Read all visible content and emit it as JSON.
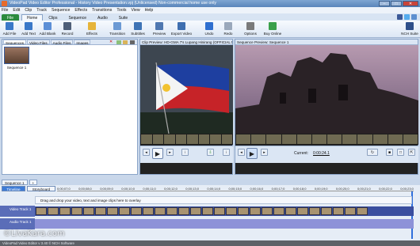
{
  "window": {
    "title": "VideoPad Video Editor Professional - History Video Presentation.vpj (Unlicensed) Non-commercial home use only",
    "controls": [
      "–",
      "□",
      "✕"
    ]
  },
  "menu": [
    "File",
    "Edit",
    "Clip",
    "Track",
    "Sequence",
    "Effects",
    "Transitions",
    "Tools",
    "View",
    "Help"
  ],
  "ribbon_tabs": [
    "File",
    "Home",
    "Clips",
    "Sequence",
    "Audio",
    "Suite"
  ],
  "ribbon": [
    {
      "label": "Add File",
      "icon": "add-file-icon",
      "color": "#3a78c8"
    },
    {
      "label": "Add Text",
      "icon": "add-text-icon",
      "color": "#3a78c8"
    },
    {
      "label": "Add Blank",
      "icon": "add-blank-icon",
      "color": "#5c8fd6"
    },
    {
      "label": "Record",
      "icon": "record-icon",
      "color": "#4f5f78"
    },
    {
      "label": "Effects",
      "icon": "effects-icon",
      "color": "#e6b43a"
    },
    {
      "label": "Transition",
      "icon": "transition-icon",
      "color": "#6c9ad4"
    },
    {
      "label": "Subtitles",
      "icon": "subtitles-icon",
      "color": "#3f74b5"
    },
    {
      "label": "Preview",
      "icon": "preview-icon",
      "color": "#5078b0"
    },
    {
      "label": "Export Video",
      "icon": "export-video-icon",
      "color": "#3f6fb0"
    },
    {
      "label": "Undo",
      "icon": "undo-icon",
      "color": "#2f6fcf"
    },
    {
      "label": "Redo",
      "icon": "redo-icon",
      "color": "#9aa8bb"
    },
    {
      "label": "Options",
      "icon": "options-icon",
      "color": "#7a7a7a"
    },
    {
      "label": "Buy Online",
      "icon": "buy-online-icon",
      "color": "#3aa04a"
    },
    {
      "label": "NCH Suite",
      "icon": "nch-suite-icon",
      "color": "#2e4f8a"
    }
  ],
  "bins": {
    "tabs": [
      "Sequences",
      "Video Files",
      "Audio Files",
      "Images"
    ],
    "active_tab": "Sequences",
    "items": [
      {
        "label": "Sequence 1"
      }
    ]
  },
  "clip_preview": {
    "header": "Clip Preview: HD-GMA 7's Lupang Hinirang (OFFICIAL M..."
  },
  "sequence_preview": {
    "header": "Sequence Preview: Sequence 1",
    "current_label": "Current:",
    "current_time": "0:00:24.1"
  },
  "sequence_tabs": [
    "Sequence 1",
    "+"
  ],
  "timeline": {
    "modes": [
      "Timeline",
      "Storyboard"
    ],
    "ruler": [
      "0;00;07;0",
      "0;00;08;0",
      "0;00;09;0",
      "0;00;10;0",
      "0;00;11;0",
      "0;00;12;0",
      "0;00;13;0",
      "0;00;14;0",
      "0;00;15;0",
      "0;00;16;0",
      "0;00;17;0",
      "0;00;18;0",
      "0;00;19;0",
      "0;00;20;0",
      "0;00;21;0",
      "0;00;22;0",
      "0;00;23;0"
    ],
    "overlay_hint": "Drag and drop your video, text and image clips here to overlay",
    "video_track": "Video Track 1",
    "audio_track": "Audio Track 1"
  },
  "statusbar": "VideoPad Video Editor v 3.40 © NCH Software",
  "watermark": "©LivaKara.com"
}
